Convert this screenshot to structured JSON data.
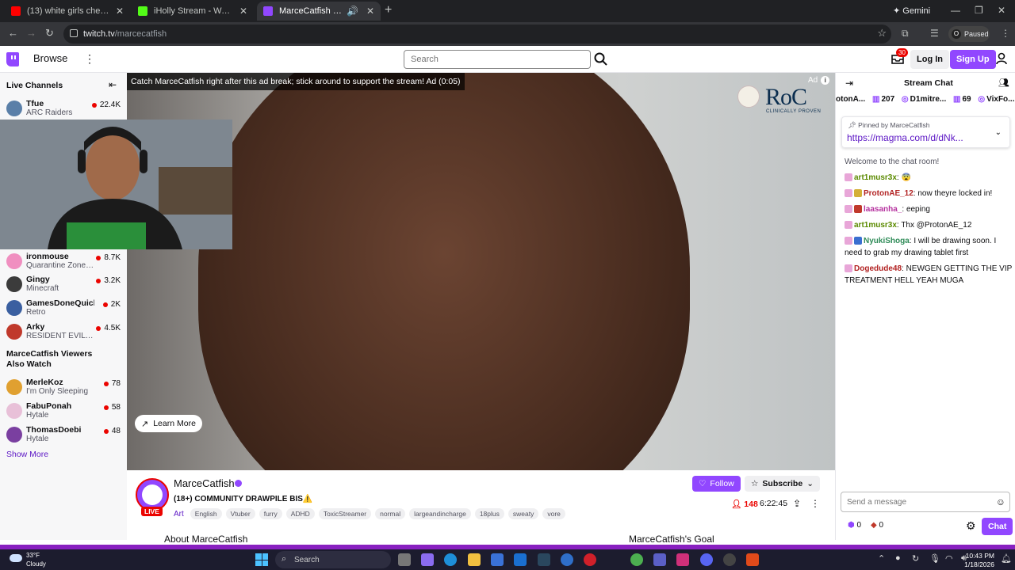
{
  "browser": {
    "tabs": [
      {
        "title": "(13) white girls cheat alot - You",
        "color": "#ff0000"
      },
      {
        "title": "iHolly Stream - Watch Live on K",
        "color": "#53fc18"
      },
      {
        "title": "MarceCatfish - Twitch",
        "color": "#9147ff"
      }
    ],
    "gemini": "Gemini",
    "url_host": "twitch.tv",
    "url_path": "/marcecatfish",
    "paused_label": "Paused",
    "profile_letter": "O"
  },
  "topnav": {
    "browse": "Browse",
    "search_placeholder": "Search",
    "notif_count": "30",
    "login": "Log In",
    "signup": "Sign Up"
  },
  "sidebar": {
    "header": "Live Channels",
    "channels": [
      {
        "name": "Tfue",
        "game": "ARC Raiders",
        "viewers": "22.4K",
        "color": "#5a7fa8"
      },
      {
        "name": "ironmouse",
        "game": "Quarantine Zone:...",
        "viewers": "8.7K",
        "color": "#f08fc0"
      },
      {
        "name": "Gingy",
        "game": "Minecraft",
        "viewers": "3.2K",
        "color": "#3b3b3b"
      },
      {
        "name": "GamesDoneQuick",
        "game": "Retro",
        "viewers": "2K",
        "color": "#3a5fa0"
      },
      {
        "name": "Arky",
        "game": "RESIDENT EVIL 7...",
        "viewers": "4.5K",
        "color": "#c0392b"
      }
    ],
    "also_watch_header": "MarceCatfish Viewers Also Watch",
    "also_watch": [
      {
        "name": "MerleKoz",
        "game": "I'm Only Sleeping",
        "viewers": "78",
        "color": "#e0a030"
      },
      {
        "name": "FabuPonah",
        "game": "Hytale",
        "viewers": "58",
        "color": "#e8c0d8"
      },
      {
        "name": "ThomasDoebi",
        "game": "Hytale",
        "viewers": "48",
        "color": "#7a3fa0"
      }
    ],
    "show_more": "Show More"
  },
  "player": {
    "ad_banner": "Catch MarceCatfish right after this ad break; stick around to support the stream! Ad (0:05)",
    "ad_tag": "Ad",
    "brand": "RoC",
    "brand_sub": "CLINICALLY PROVEN",
    "learn_more": "Learn More"
  },
  "channel": {
    "name": "MarceCatfish",
    "live": "LIVE",
    "title": "(18+) COMMUNITY DRAWPILE BIS⚠️",
    "category": "Art",
    "tags": [
      "English",
      "Vtuber",
      "furry",
      "ADHD",
      "ToxicStreamer",
      "normal",
      "largeandincharge",
      "18plus",
      "sweaty",
      "vore"
    ],
    "follow": "Follow",
    "subscribe": "Subscribe",
    "viewers": "148",
    "uptime": "6:22:45",
    "about": "About MarceCatfish",
    "goal": "MarceCatfish's Goal"
  },
  "chat": {
    "title": "Stream Chat",
    "leaderboard": [
      {
        "name": "otonA...",
        "count": ""
      },
      {
        "name": "",
        "count": "207"
      },
      {
        "name": "D1mitre...",
        "count": "69"
      },
      {
        "name": "VixFo...",
        "count": ""
      }
    ],
    "pinned_by": "Pinned by",
    "pinned_user": "MarceCatfish",
    "pinned_link": "https://magma.com/d/dNk...",
    "welcome": "Welcome to the chat room!",
    "messages": [
      {
        "user": "art1musr3x",
        "color": "#5b8a00",
        "text": "😨"
      },
      {
        "user": "ProtonAE_12",
        "color": "#b22222",
        "text": "now theyre locked in!"
      },
      {
        "user": "laasanha_",
        "color": "#b5309e",
        "text": "eeping"
      },
      {
        "user": "art1musr3x",
        "color": "#5b8a00",
        "text": "Thx @ProtonAE_12"
      },
      {
        "user": "NyukiShoga",
        "color": "#2e8b57",
        "text": "I will be drawing soon. I need to grab my drawing tablet first"
      },
      {
        "user": "Dogedude48",
        "color": "#b22222",
        "text": "NEWGEN GETTING THE VIP TREATMENT HELL YEAH MUGA"
      }
    ],
    "input_placeholder": "Send a message",
    "points_a": "0",
    "points_b": "0",
    "chat_button": "Chat"
  },
  "taskbar": {
    "temp": "33°F",
    "weather": "Cloudy",
    "search": "Search",
    "time": "10:43 PM",
    "date": "1/18/2026"
  }
}
